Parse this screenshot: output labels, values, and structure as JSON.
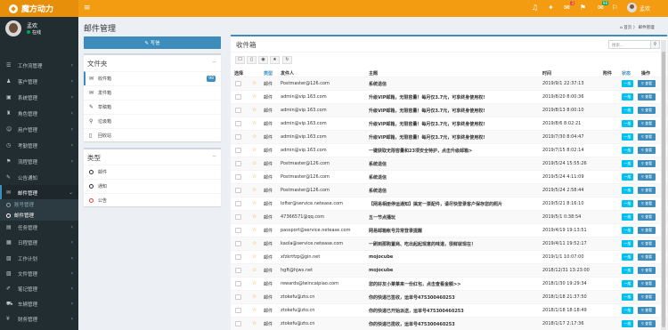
{
  "app": {
    "name": "魔方动力"
  },
  "topbar": {
    "icons": [
      {
        "name": "burger",
        "glyph": "≡"
      },
      {
        "name": "bell",
        "glyph": "🔔",
        "badge": ""
      },
      {
        "name": "puzzle",
        "glyph": "✦",
        "badge": "",
        "badge_color": "#dd4b39"
      },
      {
        "name": "comment",
        "glyph": "✉",
        "badge": "3",
        "badge_color": "#dd4b39"
      },
      {
        "name": "tasks",
        "glyph": "⚑",
        "badge": "",
        "badge_color": "#00a65a"
      },
      {
        "name": "envelope",
        "glyph": "✉",
        "badge": "98",
        "badge_color": "#00a65a"
      },
      {
        "name": "flag",
        "glyph": "⚐",
        "badge": "",
        "badge_color": "#dd4b39"
      }
    ],
    "user": "孟欢"
  },
  "sidebar": {
    "user_name": "孟欢",
    "status": "在线",
    "items": [
      {
        "label": "工作流管理",
        "icon": "☰"
      },
      {
        "label": "客户管理",
        "icon": "♟"
      },
      {
        "label": "系统管理",
        "icon": "▣"
      },
      {
        "label": "角色管理",
        "icon": "♜"
      },
      {
        "label": "用户管理",
        "icon": "☺"
      },
      {
        "label": "考勤管理",
        "icon": "◷"
      },
      {
        "label": "流程管理",
        "icon": "⚑"
      },
      {
        "label": "公告通知",
        "icon": "✎"
      },
      {
        "label": "邮件管理",
        "icon": "✉",
        "active": true
      },
      {
        "label": "任务管理",
        "icon": "▤"
      },
      {
        "label": "日程管理",
        "icon": "▦"
      },
      {
        "label": "工作计划",
        "icon": "▧"
      },
      {
        "label": "文件管理",
        "icon": "▨"
      },
      {
        "label": "笔记管理",
        "icon": "✐"
      },
      {
        "label": "车辆管理",
        "icon": "⛟"
      },
      {
        "label": "财务管理",
        "icon": "¥"
      }
    ],
    "subitems": [
      "账号管理",
      "邮件管理"
    ]
  },
  "page": {
    "title": "邮件管理",
    "breadcrumb": "⌂ 首页 〉 邮件管理"
  },
  "compose_label": "✎ 写信",
  "folders": {
    "title": "文件夹",
    "items": [
      {
        "label": "收件箱",
        "icon": "✉",
        "count": "98"
      },
      {
        "label": "发件箱",
        "icon": "✉"
      },
      {
        "label": "草稿箱",
        "icon": "✎"
      },
      {
        "label": "垃圾箱",
        "icon": "⚲"
      },
      {
        "label": "回收站",
        "icon": "🗑"
      }
    ]
  },
  "types": {
    "title": "类型",
    "items": [
      {
        "label": "邮件",
        "color": "#333333"
      },
      {
        "label": "通知",
        "color": "#333333"
      },
      {
        "label": "公告",
        "color": "#dd4b39"
      }
    ]
  },
  "inbox": {
    "title": "收件箱",
    "search_placeholder": "搜索...",
    "headers": {
      "select": "选择",
      "type": "类型",
      "sender": "发件人",
      "subject": "主题",
      "time": "时间",
      "attachment": "附件",
      "status": "状态",
      "action": "操作"
    },
    "one_label": "一般",
    "view_label": "查看",
    "rows": [
      {
        "type": "邮件",
        "sender": "Postmaster@126.com",
        "subject": "系统退信",
        "time": "2019/9/1 22:37:13"
      },
      {
        "type": "邮件",
        "sender": "admin@vip.163.com",
        "subject": "升级VIP邮箱，无限容量！每月仅3.7元，可享终身使用权!",
        "time": "2019/8/20 8:00:36"
      },
      {
        "type": "邮件",
        "sender": "admin@vip.163.com",
        "subject": "升级VIP邮箱，无限容量！每月仅3.7元，可享终身使用权!",
        "time": "2019/8/13 8:00:10"
      },
      {
        "type": "邮件",
        "sender": "admin@vip.163.com",
        "subject": "升级VIP邮箱，无限容量！每月仅3.7元，可享终身使用权!",
        "time": "2019/8/6 8:02:21"
      },
      {
        "type": "邮件",
        "sender": "admin@vip.163.com",
        "subject": "升级VIP邮箱，无限容量！每月仅3.7元，可享终身使用权!",
        "time": "2019/7/30 8:04:47"
      },
      {
        "type": "邮件",
        "sender": "admin@vip.163.com",
        "subject": "一键获取无限容量和23项安全特护，点击升级邮箱>",
        "time": "2019/7/15 8:02:14"
      },
      {
        "type": "邮件",
        "sender": "Postmaster@126.com",
        "subject": "系统退信",
        "time": "2019/5/24 15:55:26"
      },
      {
        "type": "邮件",
        "sender": "Postmaster@126.com",
        "subject": "系统退信",
        "time": "2019/5/24 4:11:09"
      },
      {
        "type": "邮件",
        "sender": "Postmaster@126.com",
        "subject": "系统退信",
        "time": "2019/5/24 2:58:44"
      },
      {
        "type": "邮件",
        "sender": "lofter@service.netease.com",
        "subject": "【网易相册停运通知】搞定一票配件，请尽快登录客户保存您的照片",
        "time": "2019/5/21 8:16:10"
      },
      {
        "type": "邮件",
        "sender": "47366571@qq.com",
        "subject": "五一节点播玩",
        "time": "2019/5/1 0:38:54"
      },
      {
        "type": "邮件",
        "sender": "passport@service.netease.com",
        "subject": "网易邮箱帐号异常登录提醒",
        "time": "2019/4/19 19:13:51"
      },
      {
        "type": "邮件",
        "sender": "kaola@service.netease.com",
        "subject": "一刷到那购置商、吃出起起现意的味道，很鲜就现在！",
        "time": "2019/4/11 19:52:17"
      },
      {
        "type": "邮件",
        "sender": "xfzkrtfzp@gin.net",
        "subject": "mojocube",
        "time": "2019/1/1 10:07:00"
      },
      {
        "type": "邮件",
        "sender": "hgft@hjws.net",
        "subject": "mojocube",
        "time": "2018/12/31 13:23:00"
      },
      {
        "type": "邮件",
        "sender": "rewards@lwincaipiao.com",
        "subject": "您的好友小莱莱来一份红包，点击查看金额>>",
        "time": "2018/1/30 19:29:34"
      },
      {
        "type": "邮件",
        "sender": "ztokefu@zto.cn",
        "subject": "你的快递已签收，运单号475300460253",
        "time": "2018/1/18 21:37:50"
      },
      {
        "type": "邮件",
        "sender": "ztokefu@zto.cn",
        "subject": "你的快递已开始派送，运单号475300460253",
        "time": "2018/1/18 18:18:49"
      },
      {
        "type": "邮件",
        "sender": "ztokefu@zto.cn",
        "subject": "你的快递已揽收，运单号475300460253",
        "time": "2018/1/17 2:17:36"
      }
    ]
  }
}
